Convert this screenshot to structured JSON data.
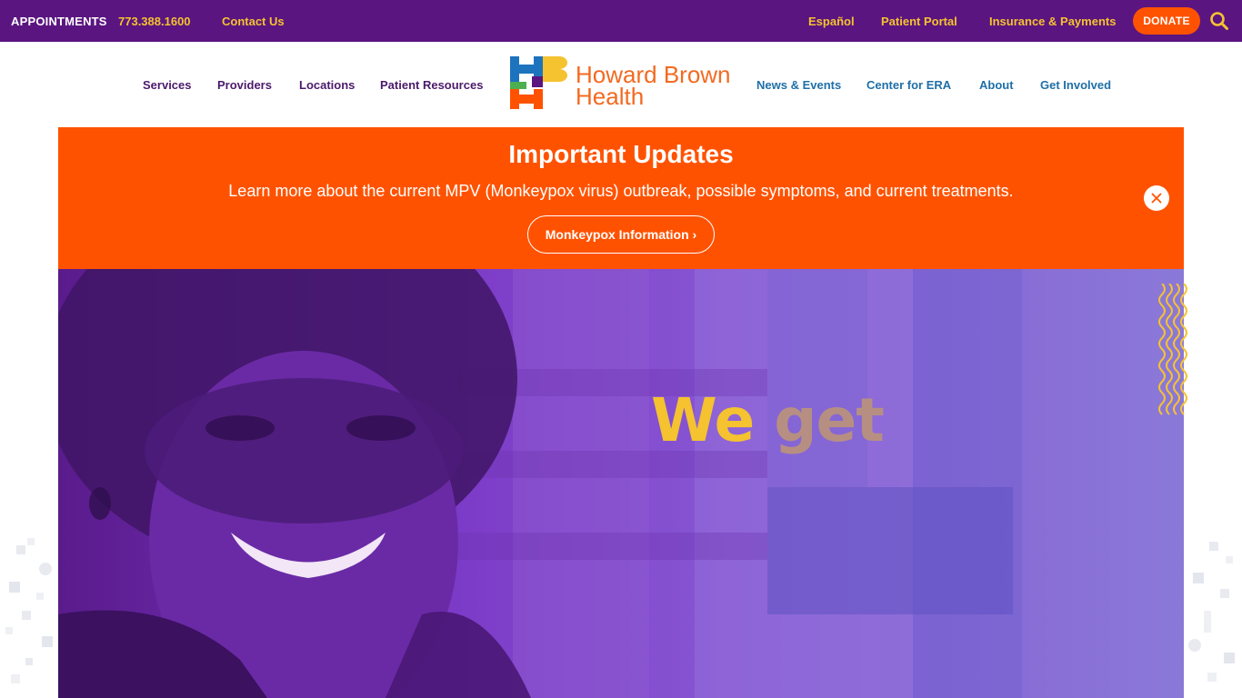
{
  "topbar": {
    "appointments_label": "APPOINTMENTS",
    "phone": "773.388.1600",
    "contact": "Contact Us",
    "espanol": "Español",
    "patient_portal": "Patient Portal",
    "insurance": "Insurance & Payments",
    "donate": "DONATE",
    "search_icon": "search-icon"
  },
  "nav": {
    "left": [
      "Services",
      "Providers",
      "Locations",
      "Patient Resources"
    ],
    "right": [
      "News & Events",
      "Center for ERA",
      "About",
      "Get Involved"
    ],
    "logo": {
      "line1": "Howard Brown",
      "line2": "Health"
    }
  },
  "alert": {
    "title": "Important Updates",
    "text": "Learn more about the current MPV (Monkeypox virus) outbreak, possible symptoms, and current treatments.",
    "button": "Monkeypox Information ›",
    "close_icon": "close-icon"
  },
  "hero": {
    "word1": "We",
    "word2": "get"
  },
  "colors": {
    "topbar_bg": "#5a1580",
    "accent_yellow": "#f5c230",
    "accent_orange": "#ff5200",
    "nav_purple": "#4b1a6b",
    "nav_blue": "#1f6fa8"
  }
}
